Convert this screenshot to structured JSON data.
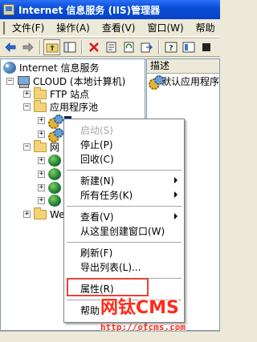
{
  "window": {
    "title": "Internet 信息服务 (IIS)管理器"
  },
  "menubar": {
    "items": [
      "文件(F)",
      "操作(A)",
      "查看(V)",
      "窗口(W)",
      "帮助"
    ]
  },
  "toolbar": {
    "buttons": [
      "back-arrow-icon",
      "forward-arrow-icon",
      "up-folder-icon",
      "show-tree-icon",
      "delete-icon",
      "properties-icon",
      "refresh-icon",
      "export-icon",
      "help-icon",
      "mmc-icon",
      "stop-icon"
    ]
  },
  "tree": {
    "root": "Internet 信息服务",
    "computer": "CLOUD (本地计算机)",
    "ftp": "FTP 站点",
    "app_pools": "应用程序池",
    "pool_item": "",
    "websites": "网站",
    "websites_visible": "网",
    "web_ext": "Web",
    "web_ext_visible": "Web"
  },
  "list": {
    "header": "描述",
    "rows": [
      "默认应用程序"
    ]
  },
  "context_menu": {
    "start": "启动(S)",
    "stop": "停止(P)",
    "recycle": "回收(C)",
    "new": "新建(N)",
    "all_tasks": "所有任务(K)",
    "view": "查看(V)",
    "new_window": "从这里创建窗口(W)",
    "refresh": "刷新(F)",
    "export_list": "导出列表(L)...",
    "properties": "属性(R)",
    "help": "帮助"
  },
  "watermark": {
    "brand": "网钛CMS",
    "url": "http://otcms.com"
  },
  "colors": {
    "titlebar": "#0a4fd8",
    "highlight_box": "#e0453c",
    "watermark": "#ff2b1a"
  }
}
